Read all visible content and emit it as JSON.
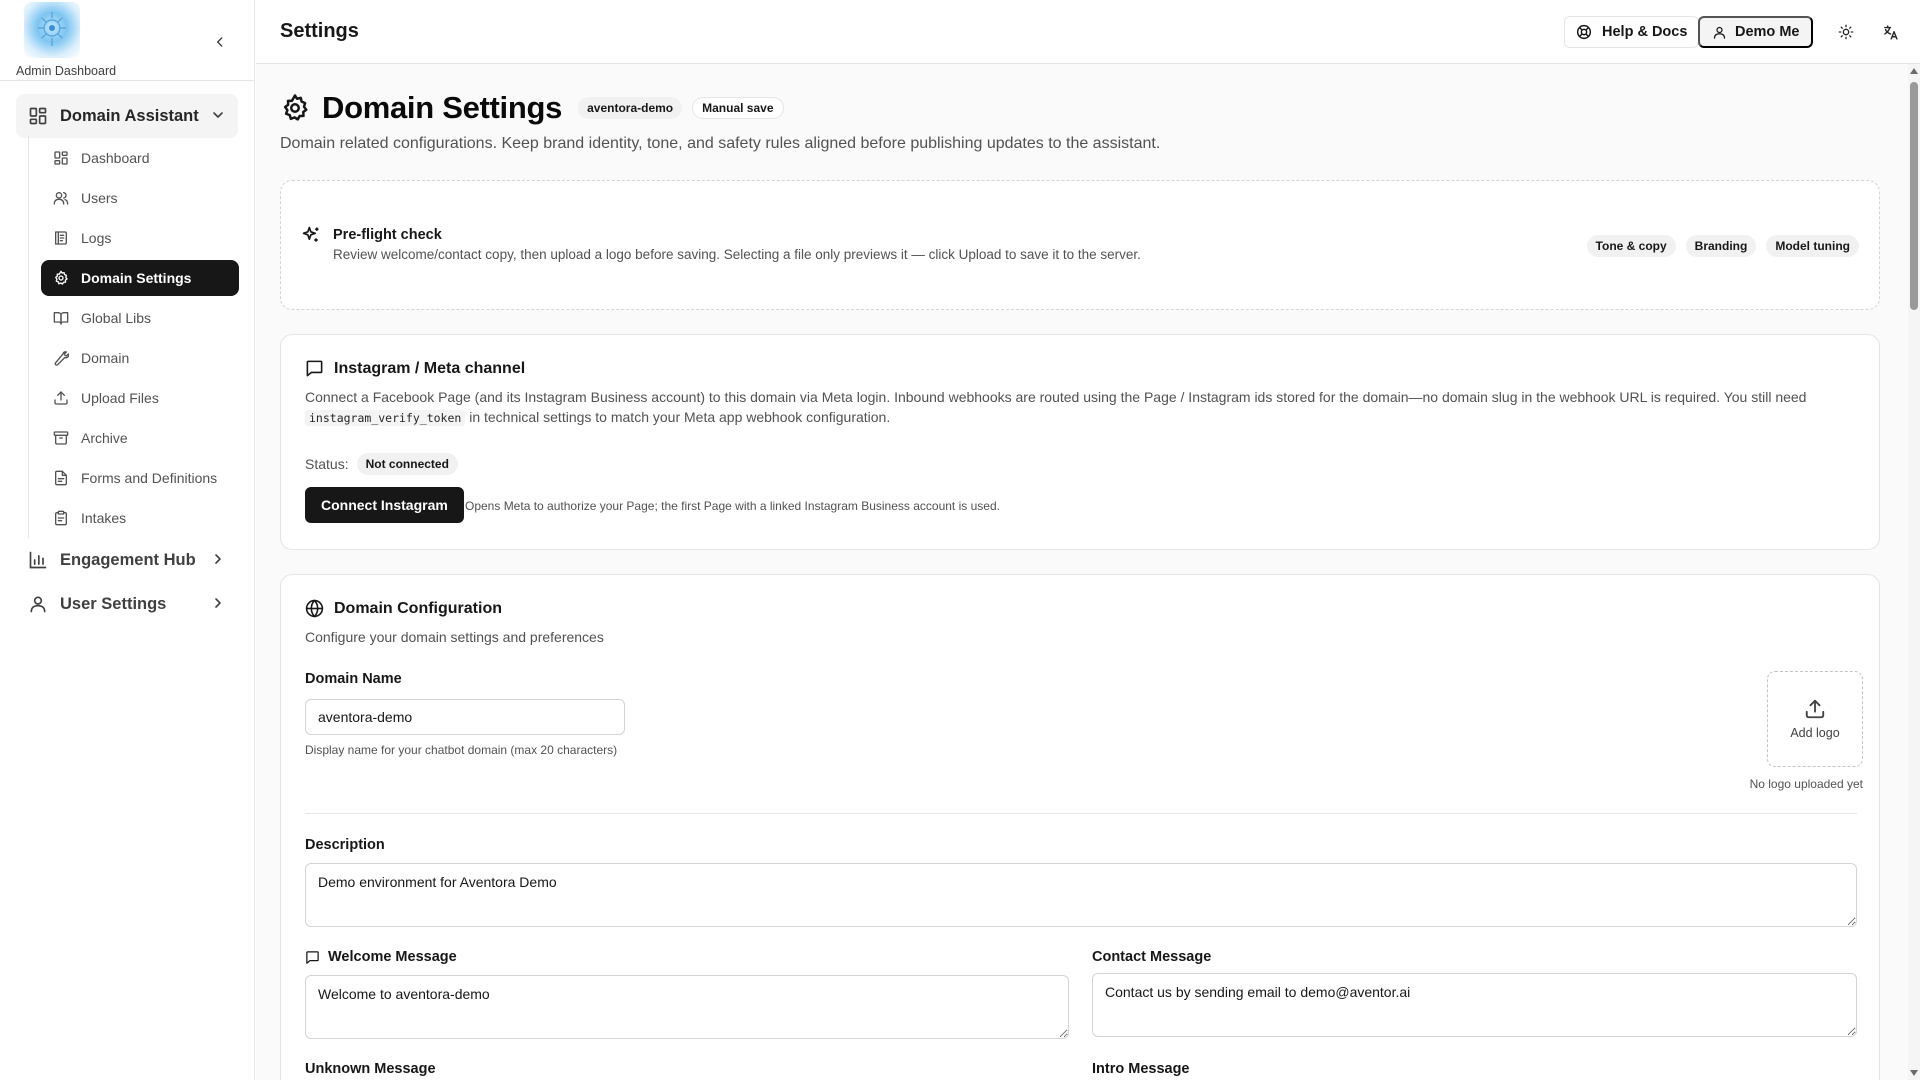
{
  "sidebar": {
    "brand_label": "Admin Dashboard",
    "groups": [
      {
        "label": "Domain Assistant",
        "expanded": true,
        "items": [
          {
            "label": "Dashboard",
            "icon": "dashboard-icon"
          },
          {
            "label": "Users",
            "icon": "users-icon"
          },
          {
            "label": "Logs",
            "icon": "logs-icon"
          },
          {
            "label": "Domain Settings",
            "icon": "gear-icon",
            "active": true
          },
          {
            "label": "Global Libs",
            "icon": "book-icon"
          },
          {
            "label": "Domain",
            "icon": "wrench-icon"
          },
          {
            "label": "Upload Files",
            "icon": "upload-icon"
          },
          {
            "label": "Archive",
            "icon": "archive-icon"
          },
          {
            "label": "Forms and Definitions",
            "icon": "file-icon"
          },
          {
            "label": "Intakes",
            "icon": "clipboard-icon"
          }
        ]
      },
      {
        "label": "Engagement Hub",
        "expanded": false
      },
      {
        "label": "User Settings",
        "expanded": false
      }
    ]
  },
  "header": {
    "title": "Settings",
    "help_label": "Help & Docs",
    "user_label": "Demo Me"
  },
  "page": {
    "title": "Domain Settings",
    "badges": [
      "aventora-demo",
      "Manual save"
    ],
    "description": "Domain related configurations. Keep brand identity, tone, and safety rules aligned before publishing updates to the assistant."
  },
  "preflight": {
    "title": "Pre-flight check",
    "description": "Review welcome/contact copy, then upload a logo before saving. Selecting a file only previews it — click Upload to save it to the server.",
    "tags": [
      "Tone & copy",
      "Branding",
      "Model tuning"
    ]
  },
  "instagram": {
    "title": "Instagram / Meta channel",
    "description_part1": "Connect a Facebook Page (and its Instagram Business account) to this domain via Meta login. Inbound webhooks are routed using the Page / Instagram ids stored for the domain—no domain slug in the webhook URL is required. You still need",
    "code_token": "instagram_verify_token",
    "description_part2": "in technical settings to match your Meta app webhook configuration.",
    "status_label": "Status:",
    "status_value": "Not connected",
    "connect_label": "Connect Instagram",
    "connect_hint": "Opens Meta to authorize your Page; the first Page with a linked Instagram Business account is used."
  },
  "domain_config": {
    "title": "Domain Configuration",
    "subtitle": "Configure your domain settings and preferences",
    "domain_name_label": "Domain Name",
    "domain_name_value": "aventora-demo",
    "domain_name_hint": "Display name for your chatbot domain (max 20 characters)",
    "add_logo_label": "Add logo",
    "logo_note": "No logo uploaded yet",
    "description_label": "Description",
    "description_value": "Demo environment for Aventora Demo",
    "welcome_label": "Welcome Message",
    "welcome_value": "Welcome to aventora-demo",
    "contact_label": "Contact Message",
    "contact_value": "Contact us by sending email to demo@aventor.ai",
    "unknown_label": "Unknown Message",
    "intro_label": "Intro Message"
  }
}
